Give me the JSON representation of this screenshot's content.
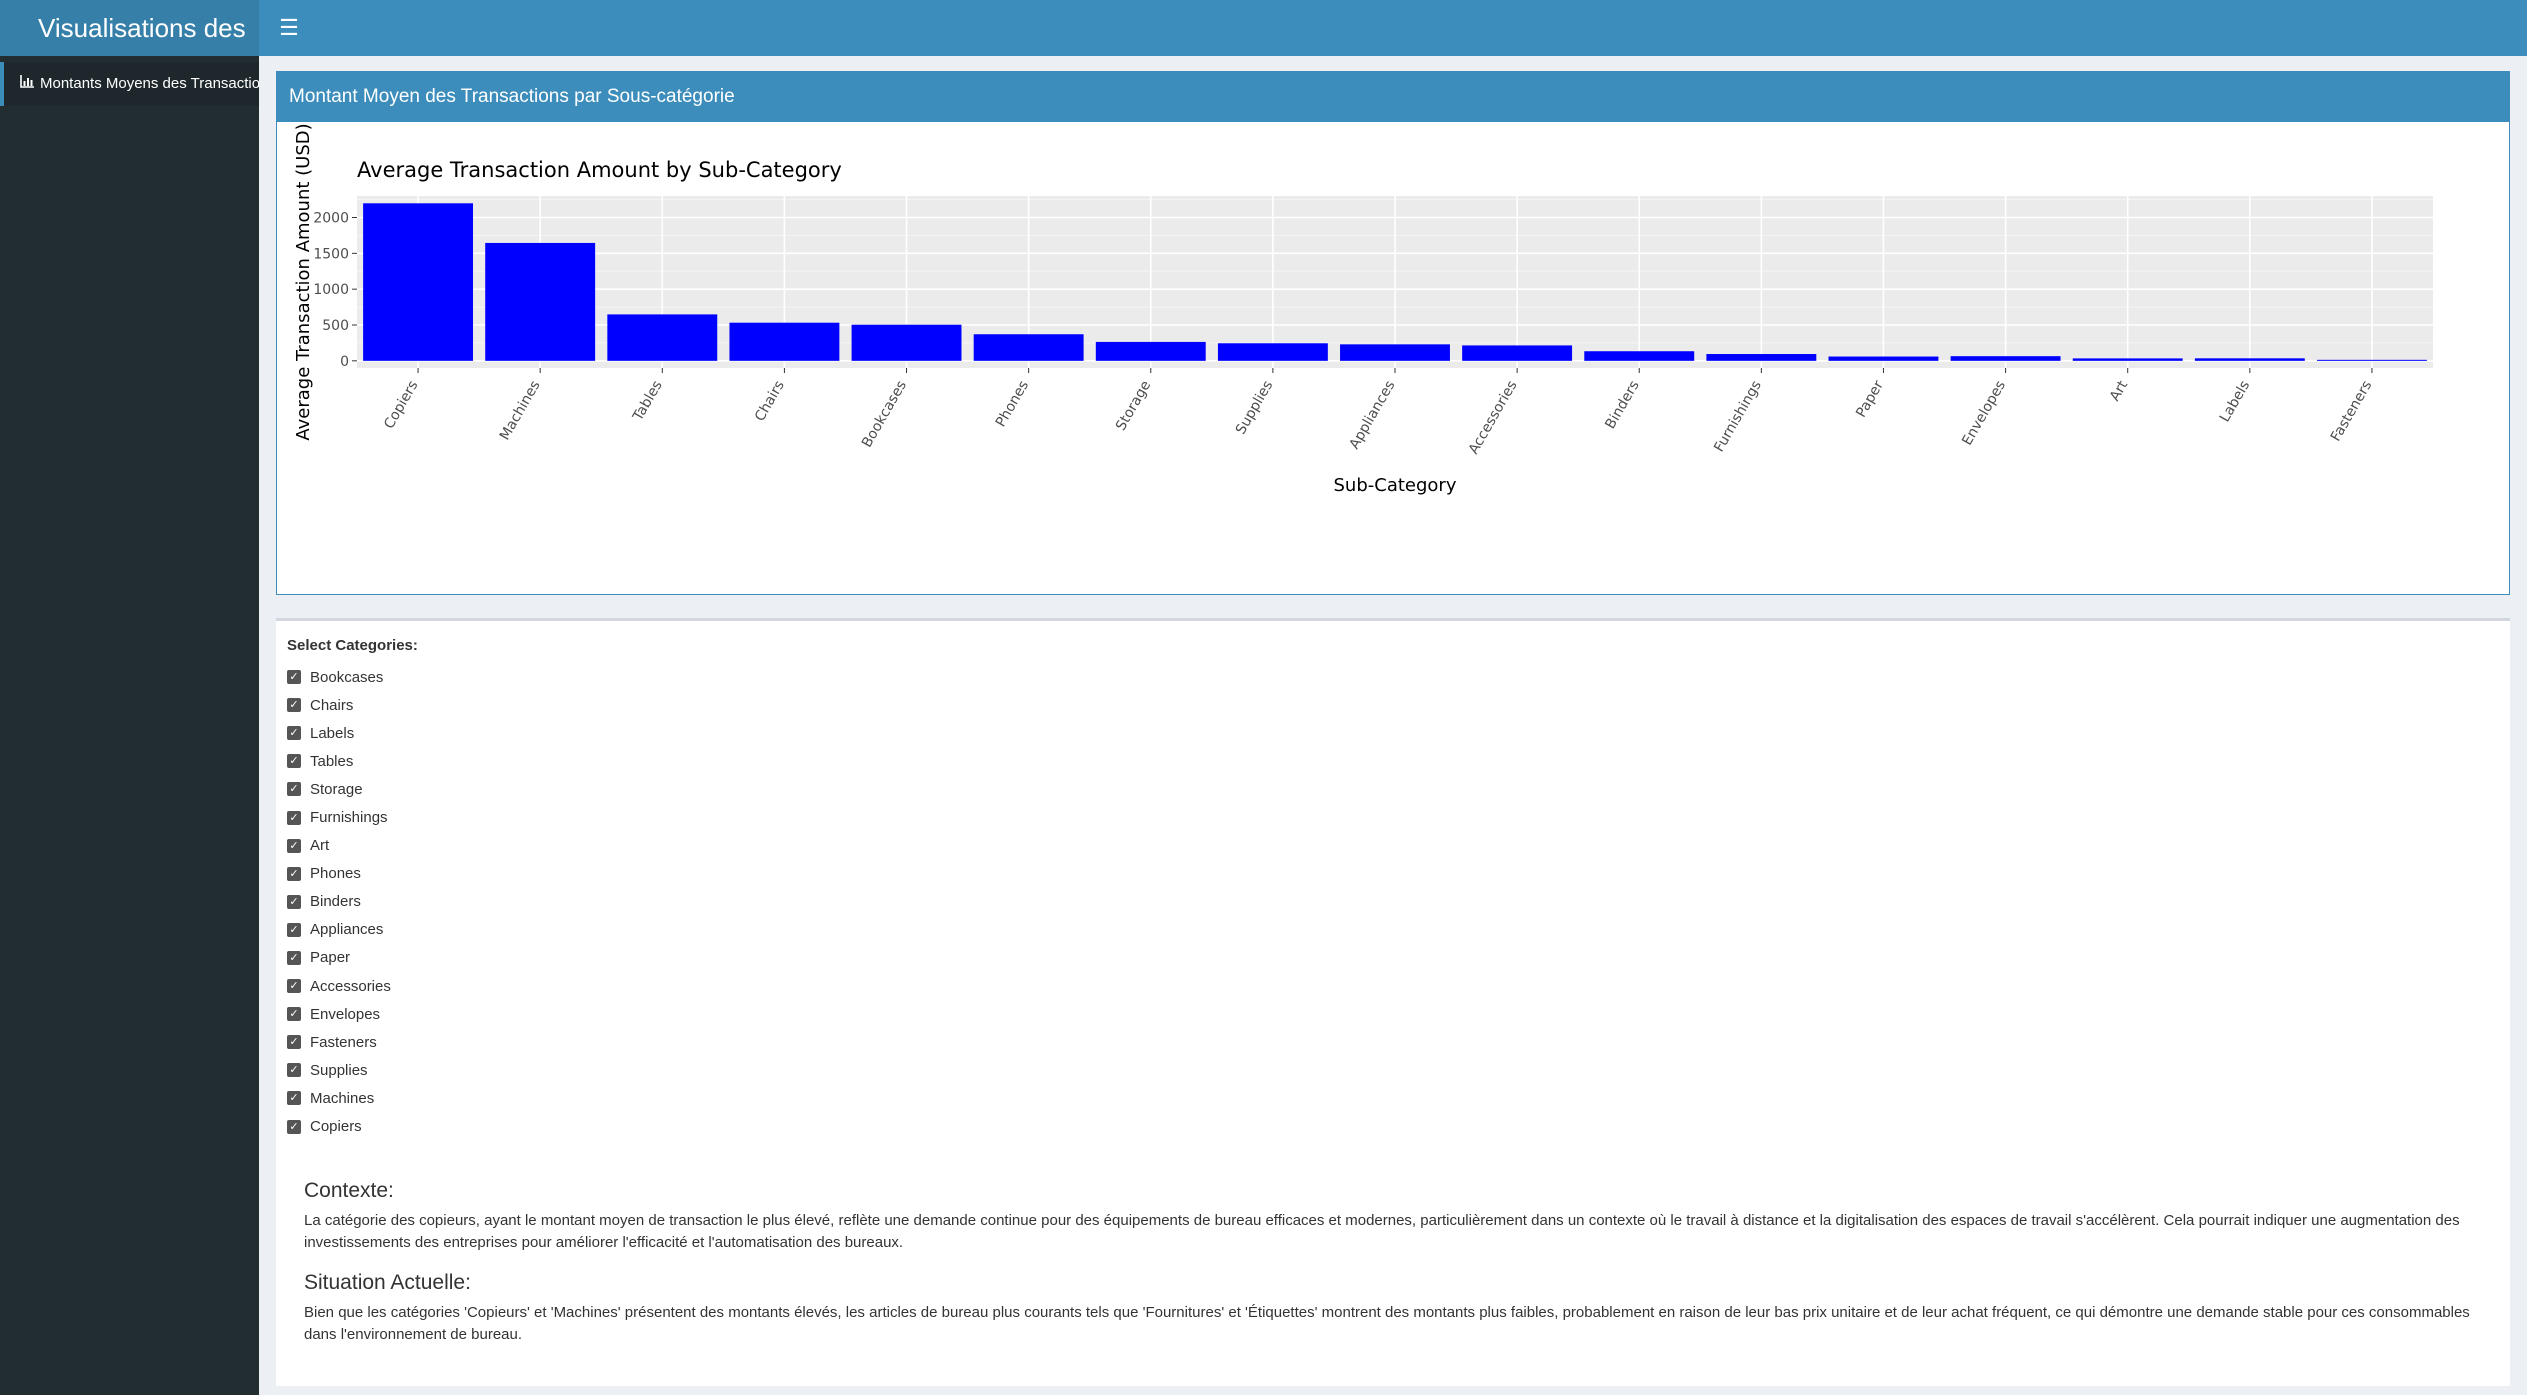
{
  "header": {
    "title": "Visualisations des",
    "menu_icon": "hamburger-icon"
  },
  "sidebar": {
    "items": [
      {
        "label": "Montants Moyens des Transactions",
        "icon": "bar-chart-icon"
      }
    ]
  },
  "box1": {
    "title": "Montant Moyen des Transactions par Sous-catégorie"
  },
  "chart_data": {
    "type": "bar",
    "title": "Average Transaction Amount by Sub-Category",
    "xlabel": "Sub-Category",
    "ylabel": "Average Transaction Amount (USD)",
    "categories": [
      "Copiers",
      "Machines",
      "Tables",
      "Chairs",
      "Bookcases",
      "Phones",
      "Storage",
      "Supplies",
      "Appliances",
      "Accessories",
      "Binders",
      "Furnishings",
      "Paper",
      "Envelopes",
      "Art",
      "Labels",
      "Fasteners"
    ],
    "values": [
      2198,
      1645,
      648,
      532,
      504,
      371,
      264,
      245,
      230,
      215,
      134,
      95,
      60,
      65,
      34,
      35,
      14
    ],
    "yticks": [
      0,
      500,
      1000,
      1500,
      2000
    ],
    "ylim": [
      -100,
      2300
    ],
    "bar_color": "#0000ff",
    "panel_color": "#ebebeb",
    "grid": true
  },
  "filters": {
    "label": "Select Categories:",
    "options": [
      "Bookcases",
      "Chairs",
      "Labels",
      "Tables",
      "Storage",
      "Furnishings",
      "Art",
      "Phones",
      "Binders",
      "Appliances",
      "Paper",
      "Accessories",
      "Envelopes",
      "Fasteners",
      "Supplies",
      "Machines",
      "Copiers"
    ],
    "checked": true
  },
  "context": {
    "title": "Contexte:",
    "text": "La catégorie des copieurs, ayant le montant moyen de transaction le plus élevé, reflète une demande continue pour des équipements de bureau efficaces et modernes, particulièrement dans un contexte où le travail à distance et la digitalisation des espaces de travail s'accélèrent. Cela pourrait indiquer une augmentation des investissements des entreprises pour améliorer l'efficacité et l'automatisation des bureaux."
  },
  "situation": {
    "title": "Situation Actuelle:",
    "text": "Bien que les catégories 'Copieurs' et 'Machines' présentent des montants élevés, les articles de bureau plus courants tels que 'Fournitures' et 'Étiquettes' montrent des montants plus faibles, probablement en raison de leur bas prix unitaire et de leur achat fréquent, ce qui démontre une demande stable pour ces consommables dans l'environnement de bureau."
  },
  "colors": {
    "header": "#3c8dbc",
    "logo": "#367fa9",
    "sidebar": "#222d32",
    "sidebar_active": "#1e282c"
  }
}
